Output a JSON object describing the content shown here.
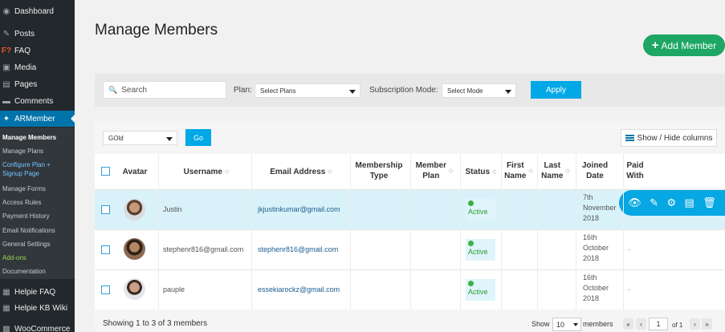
{
  "sidebar": {
    "items": [
      {
        "icon": "dashboard-icon",
        "glyph": "◉",
        "label": "Dashboard"
      },
      {
        "icon": "pin-icon",
        "glyph": "✎",
        "label": "Posts"
      },
      {
        "icon": "faq-icon",
        "glyph": "F?",
        "label": "FAQ"
      },
      {
        "icon": "media-icon",
        "glyph": "▣",
        "label": "Media"
      },
      {
        "icon": "pages-icon",
        "glyph": "▤",
        "label": "Pages"
      },
      {
        "icon": "comments-icon",
        "glyph": "▬",
        "label": "Comments"
      },
      {
        "icon": "armember-icon",
        "glyph": "✦",
        "label": "ARMember"
      }
    ],
    "submenu": [
      "Manage Members",
      "Manage Plans",
      "Configure Plan +",
      "Signup Page",
      "Manage Forms",
      "Access Rules",
      "Payment History",
      "Email Notifications",
      "General Settings",
      "Add-ons",
      "Documentation"
    ],
    "bottom_items": [
      {
        "icon": "helpie-faq-icon",
        "glyph": "▦",
        "label": "Helpie FAQ"
      },
      {
        "icon": "helpie-kb-icon",
        "glyph": "▦",
        "label": "Helpie KB Wiki"
      },
      {
        "icon": "woocommerce-icon",
        "glyph": "▩",
        "label": "WooCommerce"
      }
    ]
  },
  "page": {
    "title": "Manage Members",
    "add_button": "Add Member"
  },
  "filters": {
    "search_placeholder": "Search",
    "plan_label": "Plan:",
    "plan_value": "Select Plans",
    "mode_label": "Subscription Mode:",
    "mode_value": "Select Mode",
    "apply_label": "Apply"
  },
  "toolbar": {
    "bulk_value": "GOld",
    "go_label": "Go",
    "columns_label": "Show / Hide columns"
  },
  "table": {
    "headers": {
      "avatar": "Avatar",
      "username": "Username",
      "email": "Email Address",
      "membership_type_1": "Membership",
      "membership_type_2": "Type",
      "member_plan_1": "Member",
      "member_plan_2": "Plan",
      "status": "Status",
      "first_name_1": "First",
      "first_name_2": "Name",
      "last_name_1": "Last",
      "last_name_2": "Name",
      "joined_1": "Joined",
      "joined_2": "Date",
      "paid_1": "Paid",
      "paid_2": "With"
    },
    "rows": [
      {
        "username": "Justin",
        "email": "jkjustinkumar@gmail.com",
        "status": "Active",
        "joined_1": "7th",
        "joined_2": "November",
        "joined_3": "2018",
        "paid": ""
      },
      {
        "username": "stephenr816@gmail.com",
        "email": "stephenr816@gmail.com",
        "status": "Active",
        "joined_1": "16th",
        "joined_2": "October",
        "joined_3": "2018",
        "paid": "-"
      },
      {
        "username": "pauple",
        "email": "essekiarockz@gmail.com",
        "status": "Active",
        "joined_1": "16th",
        "joined_2": "October",
        "joined_3": "2018",
        "paid": "-"
      }
    ]
  },
  "footer": {
    "showing": "Showing 1 to 3 of 3 members",
    "show_label": "Show",
    "page_size": "10",
    "members_label": "members",
    "current_page": "1",
    "of_label": "of 1"
  },
  "colors": {
    "accent": "#00a8e6",
    "add_button": "#1da664",
    "sidebar": "#23282d"
  }
}
